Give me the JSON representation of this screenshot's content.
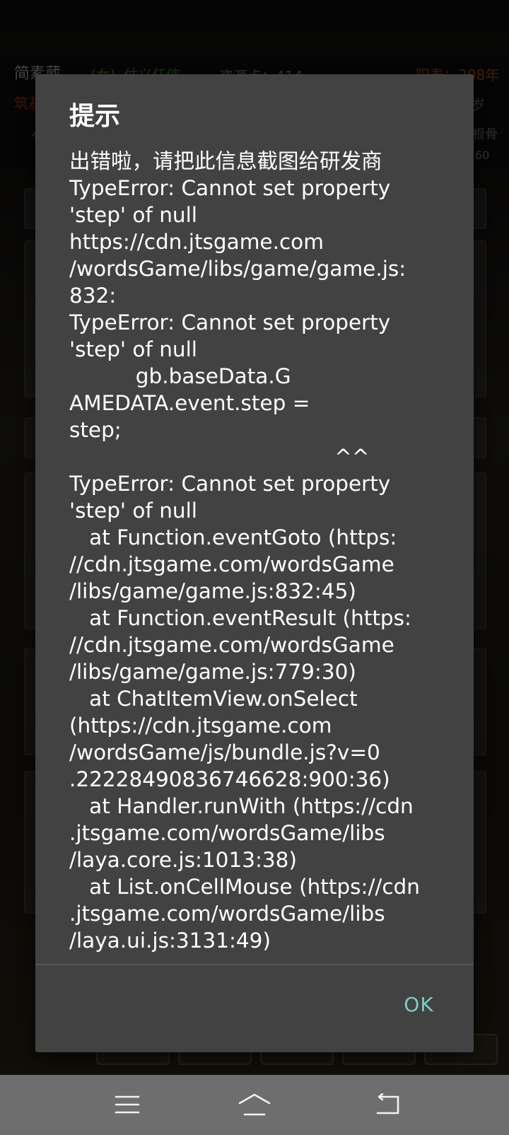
{
  "background": {
    "player_name": "简素葳",
    "gender": "(女)",
    "title_tag": "仗义任侠",
    "resource": "资源点：414",
    "lifespan": "阳寿：208年",
    "subtitle_fragment": "筑基",
    "age_fragment": "岁",
    "root_fragment": "根骨",
    "number_fragment": "60",
    "char_fragment": "亻"
  },
  "dialog": {
    "title": "提示",
    "message_lines": [
      "出错啦，请把此信息截图给研发商",
      "TypeError: Cannot set property",
      "'step' of null",
      "https://cdn.jtsgame.com",
      "/wordsGame/libs/game/game.js:",
      "832:",
      "TypeError: Cannot set property",
      "'step' of null",
      "          gb.baseData.G",
      "AMEDATA.event.step =",
      "step;",
      "                                        ^^",
      "TypeError: Cannot set property",
      "'step' of null",
      "   at Function.eventGoto (https:",
      "//cdn.jtsgame.com/wordsGame",
      "/libs/game/game.js:832:45)",
      "   at Function.eventResult (https:",
      "//cdn.jtsgame.com/wordsGame",
      "/libs/game/game.js:779:30)",
      "   at ChatItemView.onSelect",
      "(https://cdn.jtsgame.com",
      "/wordsGame/js/bundle.js?v=0",
      ".22228490836746628:900:36)",
      "   at Handler.runWith (https://cdn",
      ".jtsgame.com/wordsGame/libs",
      "/laya.core.js:1013:38)",
      "   at List.onCellMouse (https://cdn",
      ".jtsgame.com/wordsGame/libs",
      "/laya.ui.js:3131:49)"
    ],
    "ok_label": "OK"
  },
  "nav": {
    "menu_icon": "menu-icon",
    "home_icon": "home-icon",
    "back_icon": "back-icon"
  },
  "colors": {
    "dialog_bg": "#424242",
    "accent": "#80cbc4",
    "nav_bg": "#6e6e6e"
  }
}
